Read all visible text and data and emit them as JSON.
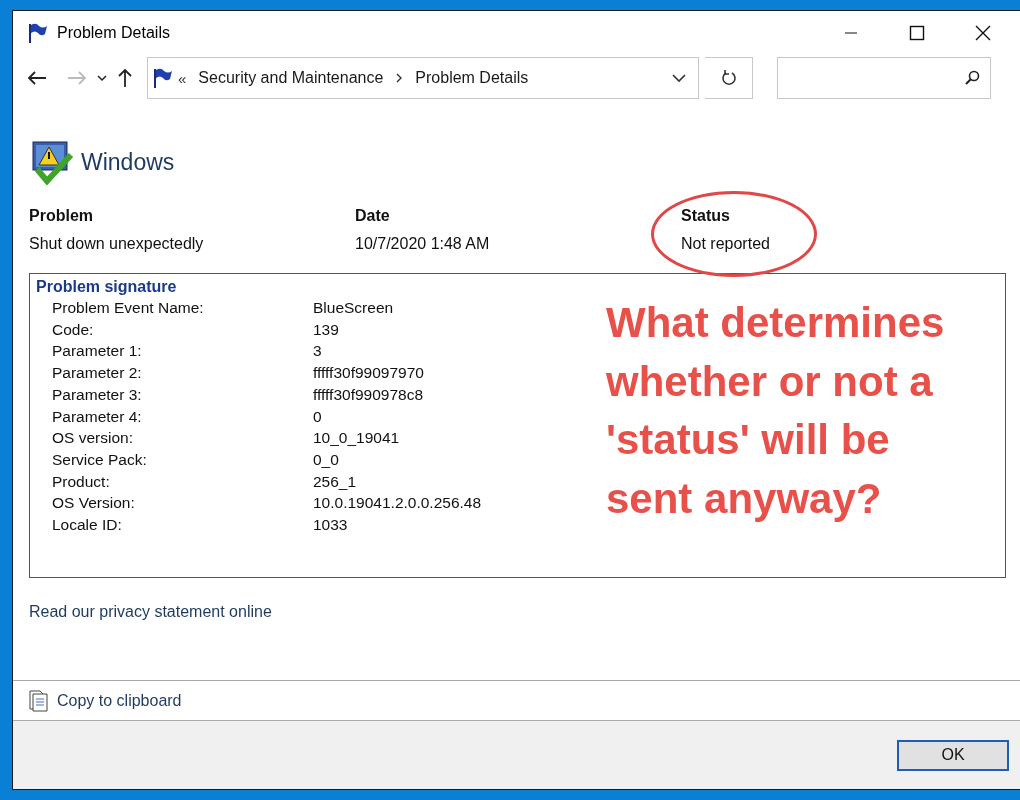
{
  "window": {
    "title": "Problem Details"
  },
  "nav": {
    "overflow": "«",
    "breadcrumb": [
      {
        "label": "Security and Maintenance"
      },
      {
        "label": "Problem Details"
      }
    ]
  },
  "header": {
    "title": "Windows"
  },
  "summary": [
    {
      "heading": "Problem",
      "value": "Shut down unexpectedly",
      "circled": false
    },
    {
      "heading": "Date",
      "value": "10/7/2020 1:48 AM",
      "circled": false
    },
    {
      "heading": "Status",
      "value": "Not reported",
      "circled": true
    }
  ],
  "signature": {
    "title": "Problem signature",
    "rows": [
      {
        "label": "Problem Event Name:",
        "value": "BlueScreen"
      },
      {
        "label": "Code:",
        "value": "139"
      },
      {
        "label": "Parameter 1:",
        "value": "3"
      },
      {
        "label": "Parameter 2:",
        "value": "fffff30f99097970"
      },
      {
        "label": "Parameter 3:",
        "value": "fffff30f990978c8"
      },
      {
        "label": "Parameter 4:",
        "value": "0"
      },
      {
        "label": "OS version:",
        "value": "10_0_19041"
      },
      {
        "label": "Service Pack:",
        "value": "0_0"
      },
      {
        "label": "Product:",
        "value": "256_1"
      },
      {
        "label": "OS Version:",
        "value": "10.0.19041.2.0.0.256.48"
      },
      {
        "label": "Locale ID:",
        "value": "1033"
      }
    ]
  },
  "annotation": {
    "text": "What determines whether or not a 'status' will be sent anyway?"
  },
  "privacy_link": "Read our privacy statement online",
  "copy_link": "Copy to clipboard",
  "buttons": [
    "OK"
  ]
}
